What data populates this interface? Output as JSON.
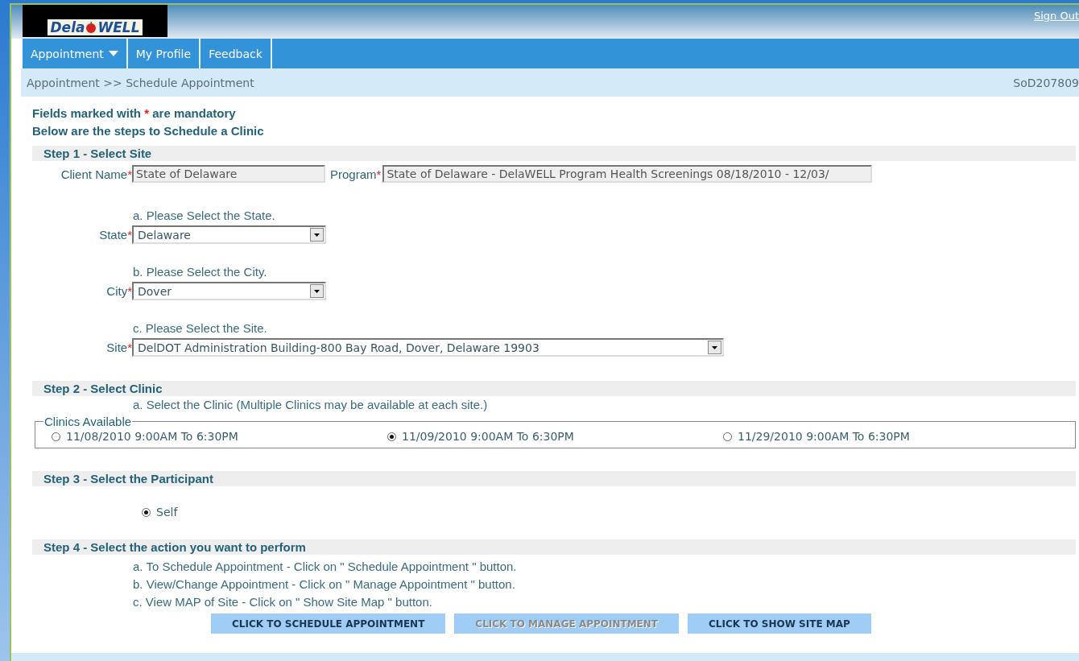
{
  "logo": {
    "left": "Dela",
    "right": "WELL"
  },
  "header": {
    "sign_out": "Sign Out"
  },
  "nav": [
    {
      "label": "Appointment",
      "has_menu": true
    },
    {
      "label": "My Profile",
      "has_menu": false
    },
    {
      "label": "Feedback",
      "has_menu": false
    }
  ],
  "breadcrumb": "Appointment >> Schedule Appointment",
  "session_code": "SoD207809",
  "intro": {
    "mandatory_before": "Fields marked with",
    "mark": "*",
    "mandatory_after": "are mandatory",
    "steps_note": "Below are the steps to Schedule a Clinic"
  },
  "step1": {
    "title": "Step 1 - Select Site",
    "client_name": {
      "label": "Client Name",
      "value": "State of Delaware"
    },
    "program": {
      "label": "Program",
      "value": "State of Delaware - DelaWELL Program Health Screenings 08/18/2010 - 12/03/"
    },
    "selects": [
      {
        "instruction": "a. Please Select the State.",
        "label": "State",
        "value": "Delaware",
        "wide": false
      },
      {
        "instruction": "b. Please Select the City.",
        "label": "City",
        "value": "Dover",
        "wide": false
      },
      {
        "instruction": "c. Please Select the Site.",
        "label": "Site",
        "value": "DelDOT Administration Building-800 Bay Road, Dover, Delaware 19903",
        "wide": true
      }
    ]
  },
  "step2": {
    "title": "Step 2 - Select Clinic",
    "instruction": "a. Select the Clinic (Multiple Clinics may be available at each site.)",
    "legend": "Clinics Available",
    "clinics": [
      {
        "label": "11/08/2010 9:00AM To 6:30PM",
        "selected": false
      },
      {
        "label": "11/09/2010 9:00AM To 6:30PM",
        "selected": true
      },
      {
        "label": "11/29/2010 9:00AM To 6:30PM",
        "selected": false
      }
    ]
  },
  "step3": {
    "title": "Step 3 - Select the Participant",
    "participants": [
      {
        "label": "Self",
        "selected": true
      }
    ]
  },
  "step4": {
    "title": "Step 4 - Select the action you want to perform",
    "lines": [
      "a. To Schedule Appointment - Click on \" Schedule Appointment \" button.",
      "b. View/Change Appointment - Click on \" Manage Appointment \" button.",
      "c. View MAP of Site - Click on \" Show Site Map \" button."
    ],
    "buttons": [
      {
        "label": "CLICK TO SCHEDULE APPOINTMENT",
        "disabled": false
      },
      {
        "label": "CLICK TO MANAGE APPOINTMENT",
        "disabled": true
      },
      {
        "label": "CLICK TO SHOW SITE MAP",
        "disabled": false
      }
    ]
  }
}
